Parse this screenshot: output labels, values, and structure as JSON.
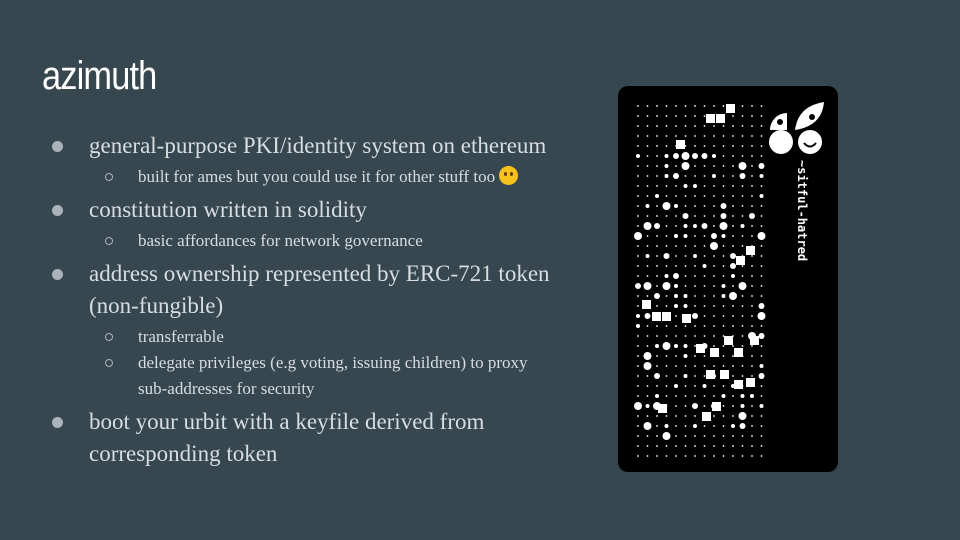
{
  "slide": {
    "title": "azimuth",
    "bullets": [
      {
        "text": "general-purpose PKI/identity system on ethereum",
        "sub": [
          {
            "text": "built for ames but you could use it for other stuff too",
            "emoji": "thinking-face-icon"
          }
        ]
      },
      {
        "text": "constitution written in solidity",
        "sub": [
          {
            "text": "basic affordances for network governance"
          }
        ]
      },
      {
        "text": "address ownership represented by ERC-721 token",
        "text2": "(non-fungible)",
        "sub": [
          {
            "text": "transferrable"
          },
          {
            "text": "delegate privileges (e.g voting, issuing children) to proxy",
            "text2": "sub-addresses for security"
          }
        ]
      },
      {
        "text": "boot your urbit with a keyfile derived from",
        "text2": "corresponding token",
        "sub": []
      }
    ]
  },
  "card": {
    "name": "~sitful-hatred",
    "colors": {
      "background": "#000000",
      "ink": "#ffffff"
    }
  },
  "colors": {
    "slide_bg": "#37474f",
    "title": "#ffffff",
    "body_text": "#d7dde0"
  }
}
